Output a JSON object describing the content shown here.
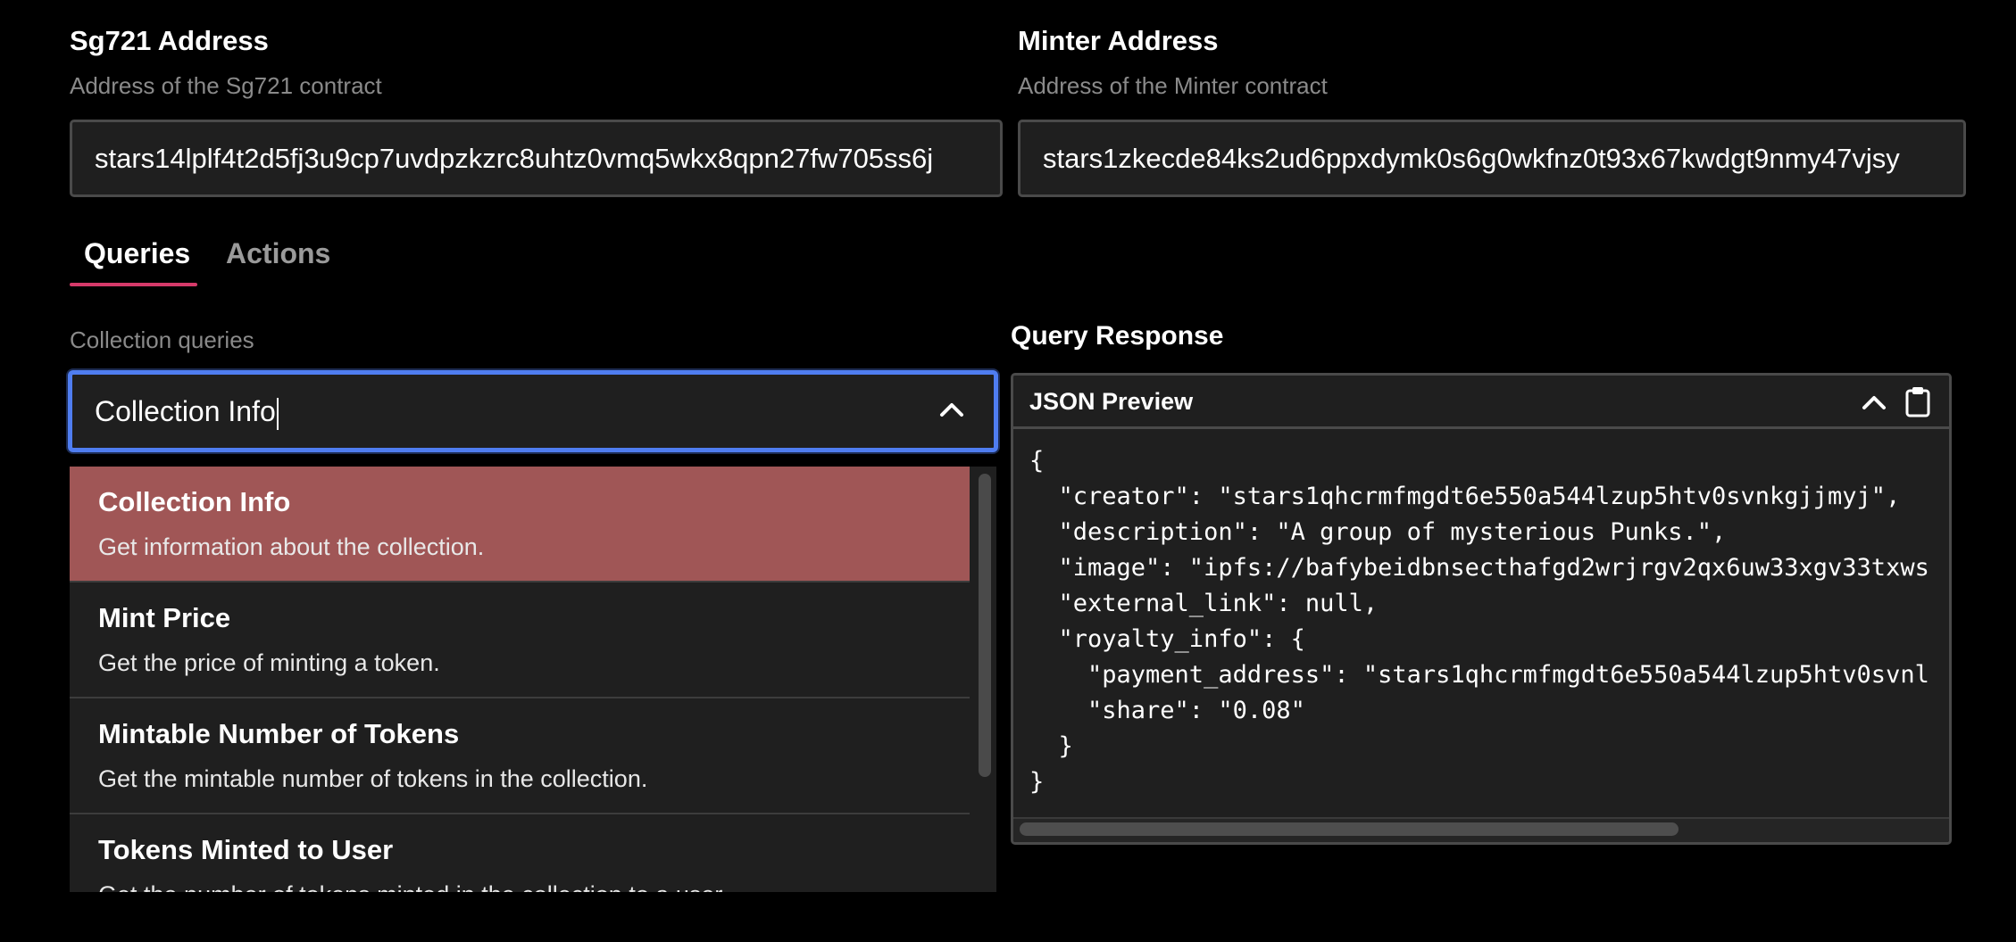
{
  "sg721": {
    "title": "Sg721 Address",
    "subtitle": "Address of the Sg721 contract",
    "value": "stars14lplf4t2d5fj3u9cp7uvdpzkzrc8uhtz0vmq5wkx8qpn27fw705ss6j"
  },
  "minter": {
    "title": "Minter Address",
    "subtitle": "Address of the Minter contract",
    "value": "stars1zkecde84ks2ud6ppxdymk0s6g0wkfnz0t93x67kwdgt9nmy47vjsy"
  },
  "tabs": [
    {
      "label": "Queries",
      "active": true
    },
    {
      "label": "Actions",
      "active": false
    }
  ],
  "queries": {
    "label": "Collection queries",
    "input_value": "Collection Info",
    "options": [
      {
        "title": "Collection Info",
        "description": "Get information about the collection.",
        "highlighted": true
      },
      {
        "title": "Mint Price",
        "description": "Get the price of minting a token."
      },
      {
        "title": "Mintable Number of Tokens",
        "description": "Get the mintable number of tokens in the collection."
      },
      {
        "title": "Tokens Minted to User",
        "description": "Get the number of tokens minted in the collection to a user."
      }
    ]
  },
  "response": {
    "title": "Query Response",
    "panel_title": "JSON Preview",
    "lines": [
      "{",
      "  \"creator\": \"stars1qhcrmfmgdt6e550a544lzup5htv0svnkgjjmyj\",",
      "  \"description\": \"A group of mysterious Punks.\",",
      "  \"image\": \"ipfs://bafybeidbnsecthafgd2wrjrgv2qx6uw33xgv33txws",
      "  \"external_link\": null,",
      "  \"royalty_info\": {",
      "    \"payment_address\": \"stars1qhcrmfmgdt6e550a544lzup5htv0svnl",
      "    \"share\": \"0.08\"",
      "  }",
      "}"
    ]
  },
  "colors": {
    "background": "#000000",
    "field_bg": "#1f1f1f",
    "focus_border": "#4f7df0",
    "tab_underline": "#d63a6a",
    "highlight_option": "#a05656"
  }
}
